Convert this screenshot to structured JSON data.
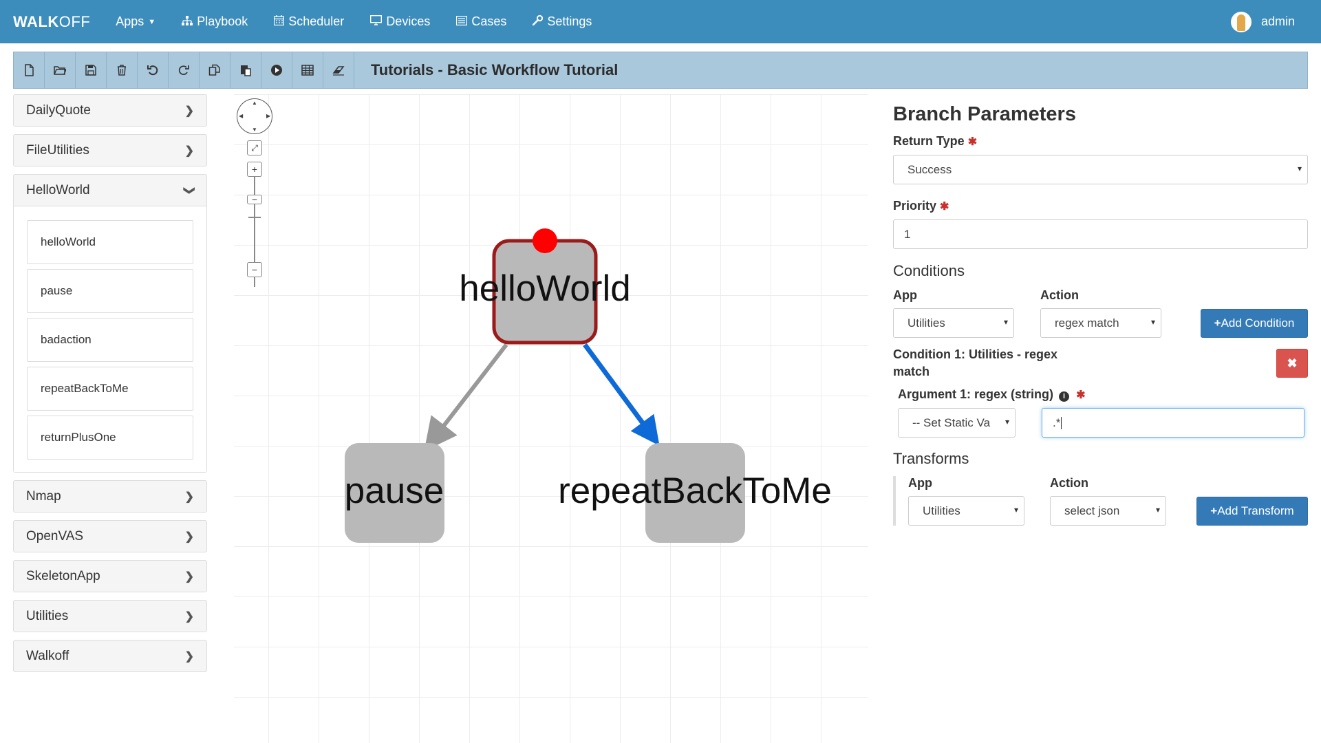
{
  "navbar": {
    "brand_bold": "WALK",
    "brand_thin": "OFF",
    "items": [
      {
        "label": "Apps",
        "icon": "caret-down-icon"
      },
      {
        "label": "Playbook",
        "icon": "sitemap-icon"
      },
      {
        "label": "Scheduler",
        "icon": "calendar-icon"
      },
      {
        "label": "Devices",
        "icon": "monitor-icon"
      },
      {
        "label": "Cases",
        "icon": "list-icon"
      },
      {
        "label": "Settings",
        "icon": "wrench-icon"
      }
    ],
    "user": "admin"
  },
  "toolbar": {
    "buttons": [
      "new-file-icon",
      "open-folder-icon",
      "save-icon",
      "delete-icon",
      "undo-icon",
      "redo-icon",
      "copy-icon",
      "paste-icon",
      "execute-icon",
      "table-icon",
      "eraser-icon"
    ],
    "title": "Tutorials - Basic Workflow Tutorial"
  },
  "sidebar": {
    "apps": [
      {
        "name": "DailyQuote",
        "expanded": false
      },
      {
        "name": "FileUtilities",
        "expanded": false
      },
      {
        "name": "HelloWorld",
        "expanded": true,
        "actions": [
          "helloWorld",
          "pause",
          "badaction",
          "repeatBackToMe",
          "returnPlusOne"
        ]
      },
      {
        "name": "Nmap",
        "expanded": false
      },
      {
        "name": "OpenVAS",
        "expanded": false
      },
      {
        "name": "SkeletonApp",
        "expanded": false
      },
      {
        "name": "Utilities",
        "expanded": false
      },
      {
        "name": "Walkoff",
        "expanded": false
      }
    ]
  },
  "graph": {
    "nodes": [
      {
        "id": "helloWorld",
        "label": "helloWorld",
        "start": true,
        "selected": true
      },
      {
        "id": "pause",
        "label": "pause"
      },
      {
        "id": "repeatBackToMe",
        "label": "repeatBackToMe"
      }
    ],
    "edges": [
      {
        "from": "helloWorld",
        "to": "pause",
        "selected": false
      },
      {
        "from": "helloWorld",
        "to": "repeatBackToMe",
        "selected": true
      }
    ],
    "colors": {
      "node": "#b9b9b9",
      "selected_border": "#9b1b1b",
      "start_marker": "#ff0000",
      "edge": "#999999",
      "edge_selected": "#0e6ad6"
    }
  },
  "panel": {
    "title": "Branch Parameters",
    "return_type_label": "Return Type",
    "return_type_value": "Success",
    "priority_label": "Priority",
    "priority_value": "1",
    "conditions_title": "Conditions",
    "app_label": "App",
    "action_label": "Action",
    "condition_app_value": "Utilities",
    "condition_action_value": "regex match",
    "add_condition_label": "Add Condition",
    "condition_title": "Condition 1: Utilities - regex match",
    "argument_label": "Argument 1: regex (string)",
    "argument_source_value": "-- Set Static Va",
    "argument_value": ".*",
    "transforms_title": "Transforms",
    "transform_app_value": "Utilities",
    "transform_action_value": "select json",
    "add_transform_label": "Add Transform"
  }
}
